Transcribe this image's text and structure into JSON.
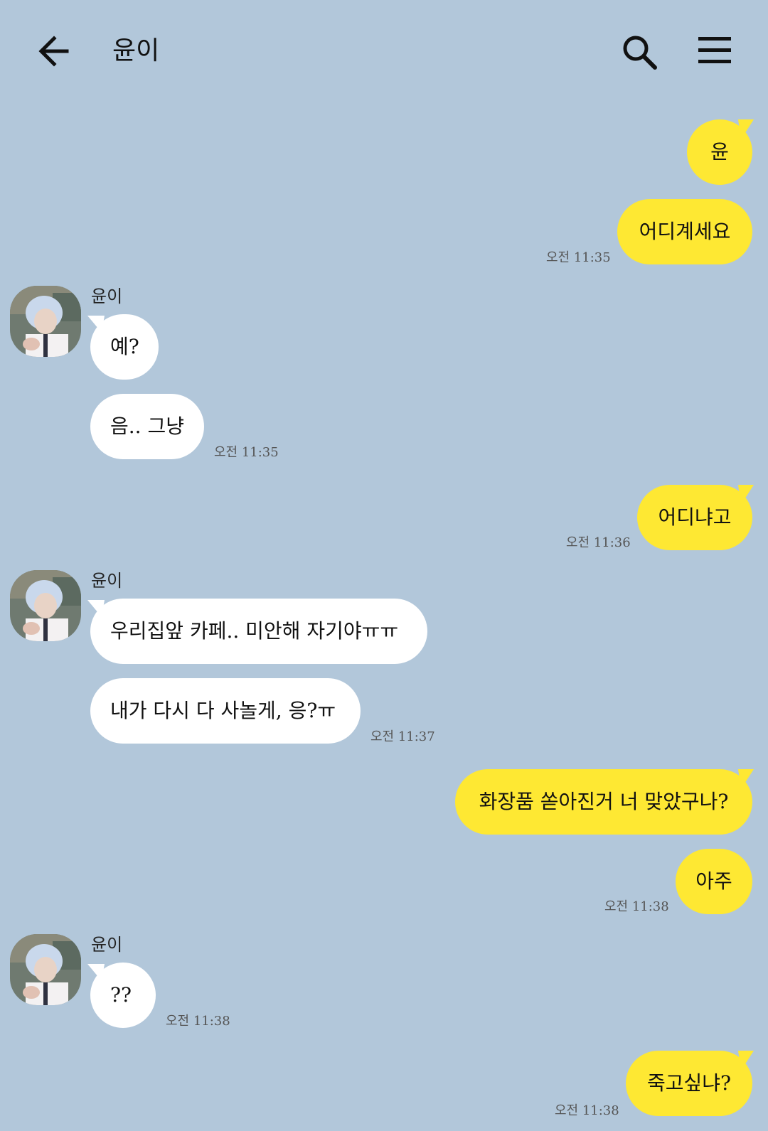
{
  "theme": {
    "background": "#b2c7da",
    "outgoing_bubble": "#fee833",
    "incoming_bubble": "#ffffff"
  },
  "header": {
    "title": "윤이",
    "back_icon": "arrow-left-icon",
    "search_icon": "search-icon",
    "menu_icon": "hamburger-menu-icon"
  },
  "messages": {
    "out1": {
      "text": "윤"
    },
    "out2": {
      "text": "어디계세요",
      "time": "오전 11:35"
    },
    "in1": {
      "sender": "윤이",
      "text": "예?"
    },
    "in2": {
      "text": "음.. 그냥",
      "time": "오전 11:35"
    },
    "out3": {
      "text": "어디냐고",
      "time": "오전 11:36"
    },
    "in3": {
      "sender": "윤이",
      "text": "우리집앞 카페.. 미안해 자기야ㅠㅠ"
    },
    "in4": {
      "text": "내가 다시 다 사놀게, 응?ㅠ",
      "time": "오전 11:37"
    },
    "out4": {
      "text": "화장품 쏟아진거 너 맞았구나?"
    },
    "out5": {
      "text": "아주",
      "time": "오전 11:38"
    },
    "in5": {
      "sender": "윤이",
      "text": "??",
      "time": "오전 11:38"
    },
    "out6": {
      "text": "죽고싶냐?",
      "time": "오전 11:38"
    }
  }
}
